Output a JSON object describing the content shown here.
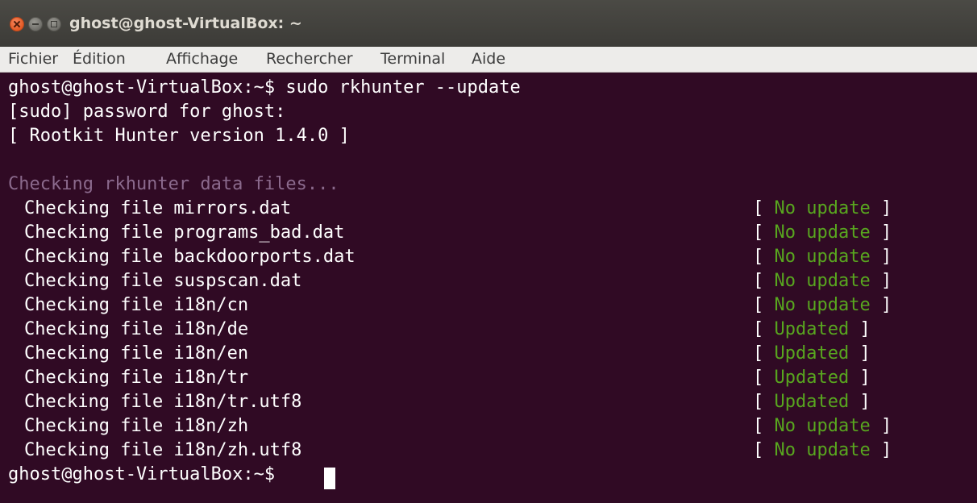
{
  "window": {
    "title": "ghost@ghost-VirtualBox: ~",
    "buttons": [
      "close-icon",
      "minimize-icon",
      "maximize-icon"
    ]
  },
  "menu": {
    "items": [
      "Fichier",
      "Édition",
      "Affichage",
      "Rechercher",
      "Terminal",
      "Aide"
    ]
  },
  "terminal": {
    "colors": {
      "background": "#300a24",
      "foreground": "#ffffff",
      "dim": "#8b6a8d",
      "green": "#58a61f"
    },
    "lines": [
      "ghost@ghost-VirtualBox:~$ sudo rkhunter --update",
      "[sudo] password for ghost:",
      "[ Rootkit Hunter version 1.4.0 ]",
      "",
      "Checking rkhunter data files..."
    ],
    "files": [
      {
        "label": "Checking file mirrors.dat",
        "status": "No update"
      },
      {
        "label": "Checking file programs_bad.dat",
        "status": "No update"
      },
      {
        "label": "Checking file backdoorports.dat",
        "status": "No update"
      },
      {
        "label": "Checking file suspscan.dat",
        "status": "No update"
      },
      {
        "label": "Checking file i18n/cn",
        "status": "No update"
      },
      {
        "label": "Checking file i18n/de",
        "status": "Updated"
      },
      {
        "label": "Checking file i18n/en",
        "status": "Updated"
      },
      {
        "label": "Checking file i18n/tr",
        "status": "Updated"
      },
      {
        "label": "Checking file i18n/tr.utf8",
        "status": "Updated"
      },
      {
        "label": "Checking file i18n/zh",
        "status": "No update"
      },
      {
        "label": "Checking file i18n/zh.utf8",
        "status": "No update"
      }
    ],
    "prompt": "ghost@ghost-VirtualBox:~$",
    "bracket_open": "[ ",
    "bracket_close": " ]"
  }
}
